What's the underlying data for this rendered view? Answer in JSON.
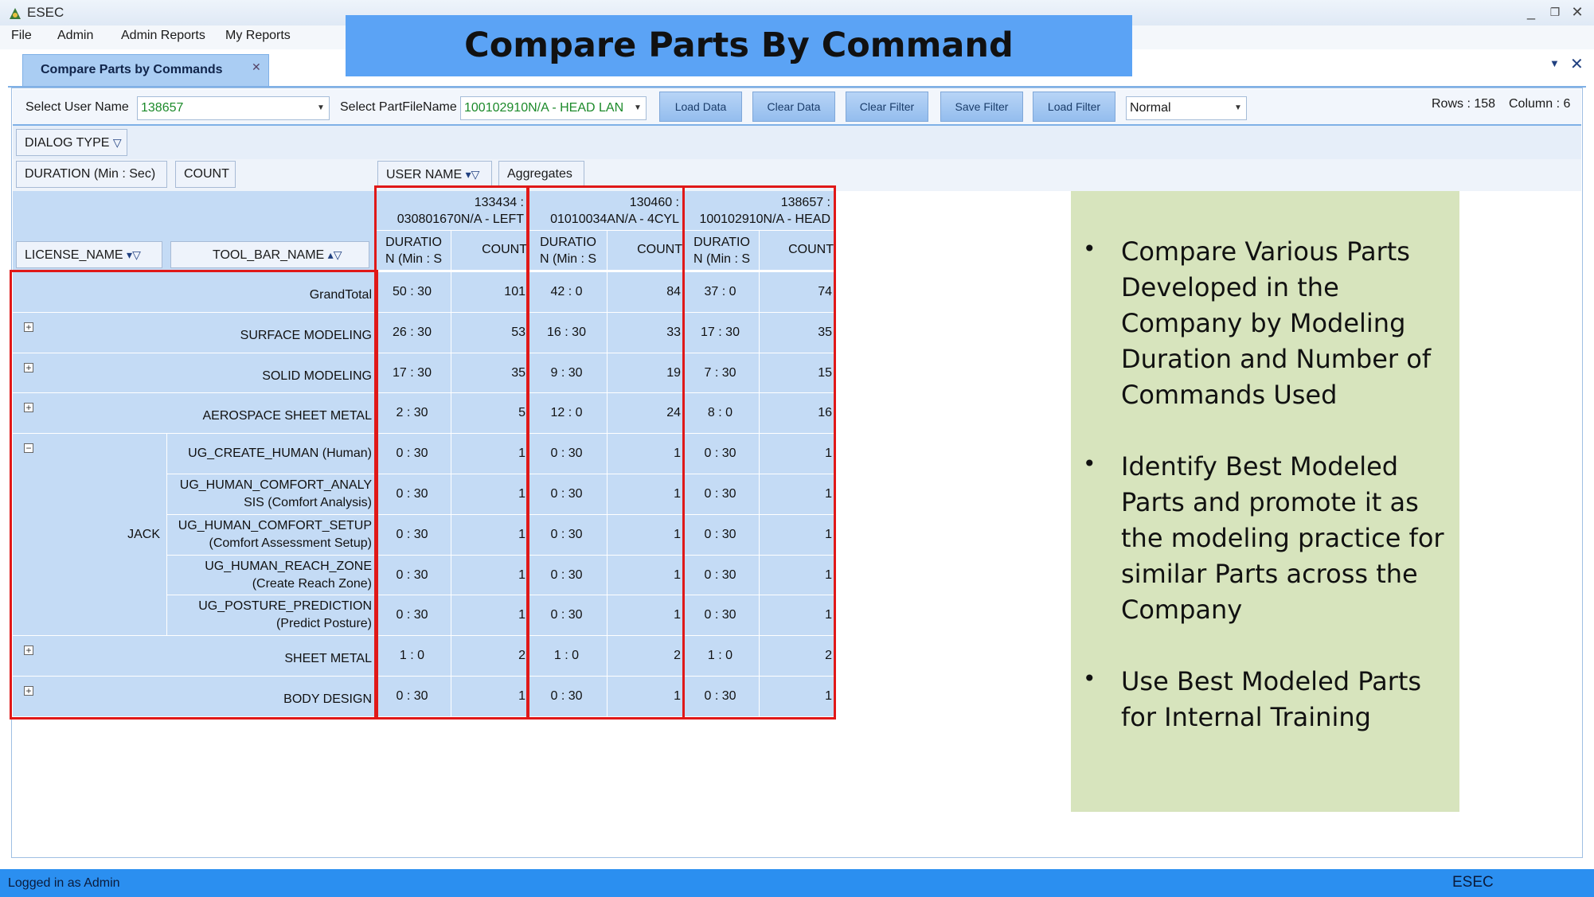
{
  "window": {
    "title": "ESEC"
  },
  "menu": [
    "File",
    "Admin",
    "Admin Reports",
    "My Reports"
  ],
  "banner": "Compare Parts By Command",
  "tab": {
    "label": "Compare Parts by Commands"
  },
  "toolbar": {
    "user_label": "Select User Name",
    "user_value": "138657",
    "part_label": "Select PartFileName",
    "part_value": "100102910N/A - HEAD LAN",
    "buttons": [
      "Load Data",
      "Clear Data",
      "Clear Filter",
      "Save Filter",
      "Load Filter"
    ],
    "mode_value": "Normal",
    "rows_text": "Rows : 158",
    "column_text": "Column : 6"
  },
  "fields": {
    "dialog_type": "DIALOG TYPE",
    "duration": "DURATION (Min : Sec)",
    "count": "COUNT",
    "user_name": "USER NAME",
    "aggregates": "Aggregates",
    "license_name": "LICENSE_NAME",
    "tool_bar_name": "TOOL_BAR_NAME"
  },
  "pivot": {
    "columns": [
      {
        "user": "133434 :",
        "part": "030801670N/A - LEFT",
        "dur_l1": "DURATIO",
        "dur_l2": "N (Min : S",
        "count": "COUNT"
      },
      {
        "user": "130460 :",
        "part": "01010034AN/A - 4CYL",
        "dur_l1": "DURATIO",
        "dur_l2": "N (Min : S",
        "count": "COUNT"
      },
      {
        "user": "138657 :",
        "part": "100102910N/A - HEAD",
        "dur_l1": "DURATIO",
        "dur_l2": "N (Min : S",
        "count": "COUNT"
      }
    ],
    "grand_total": {
      "label": "GrandTotal",
      "values": [
        "50 : 30",
        "101",
        "42 : 0",
        "84",
        "37 : 0",
        "74"
      ]
    },
    "rows": [
      {
        "label": "SURFACE MODELING",
        "values": [
          "26 : 30",
          "53",
          "16 : 30",
          "33",
          "17 : 30",
          "35"
        ]
      },
      {
        "label": "SOLID MODELING",
        "values": [
          "17 : 30",
          "35",
          "9 : 30",
          "19",
          "7 : 30",
          "15"
        ]
      },
      {
        "label": "AEROSPACE SHEET METAL",
        "values": [
          "2 : 30",
          "5",
          "12 : 0",
          "24",
          "8 : 0",
          "16"
        ]
      }
    ],
    "jack": {
      "label": "JACK",
      "children": [
        {
          "l1": "UG_CREATE_HUMAN (Human)",
          "l2": "",
          "values": [
            "0 : 30",
            "1",
            "0 : 30",
            "1",
            "0 : 30",
            "1"
          ]
        },
        {
          "l1": "UG_HUMAN_COMFORT_ANALY",
          "l2": "SIS (Comfort Analysis)",
          "values": [
            "0 : 30",
            "1",
            "0 : 30",
            "1",
            "0 : 30",
            "1"
          ]
        },
        {
          "l1": "UG_HUMAN_COMFORT_SETUP",
          "l2": "(Comfort Assessment Setup)",
          "values": [
            "0 : 30",
            "1",
            "0 : 30",
            "1",
            "0 : 30",
            "1"
          ]
        },
        {
          "l1": "UG_HUMAN_REACH_ZONE",
          "l2": "(Create Reach Zone)",
          "values": [
            "0 : 30",
            "1",
            "0 : 30",
            "1",
            "0 : 30",
            "1"
          ]
        },
        {
          "l1": "UG_POSTURE_PREDICTION",
          "l2": "(Predict Posture)",
          "values": [
            "0 : 30",
            "1",
            "0 : 30",
            "1",
            "0 : 30",
            "1"
          ]
        }
      ]
    },
    "tail_rows": [
      {
        "label": "SHEET METAL",
        "values": [
          "1 : 0",
          "2",
          "1 : 0",
          "2",
          "1 : 0",
          "2"
        ]
      },
      {
        "label": "BODY DESIGN",
        "values": [
          "0 : 30",
          "1",
          "0 : 30",
          "1",
          "0 : 30",
          "1"
        ]
      }
    ]
  },
  "notes": [
    {
      "lines": [
        "Compare Various Parts",
        "Developed in the",
        "Company by Modeling",
        "Duration and Number of",
        "Commands Used"
      ]
    },
    {
      "lines": [
        "Identify Best Modeled",
        "Parts and promote it as",
        "the modeling practice for",
        "similar Parts across the",
        "Company"
      ]
    },
    {
      "lines": [
        "Use Best Modeled Parts",
        "for Internal Training"
      ]
    }
  ],
  "status": {
    "left": "Logged in as Admin",
    "right": "ESEC"
  },
  "colors": {
    "accent": "#5ba3f5",
    "highlight": "#e01818",
    "notes_bg": "#d7e4bd",
    "status_bg": "#2b8ff0"
  }
}
